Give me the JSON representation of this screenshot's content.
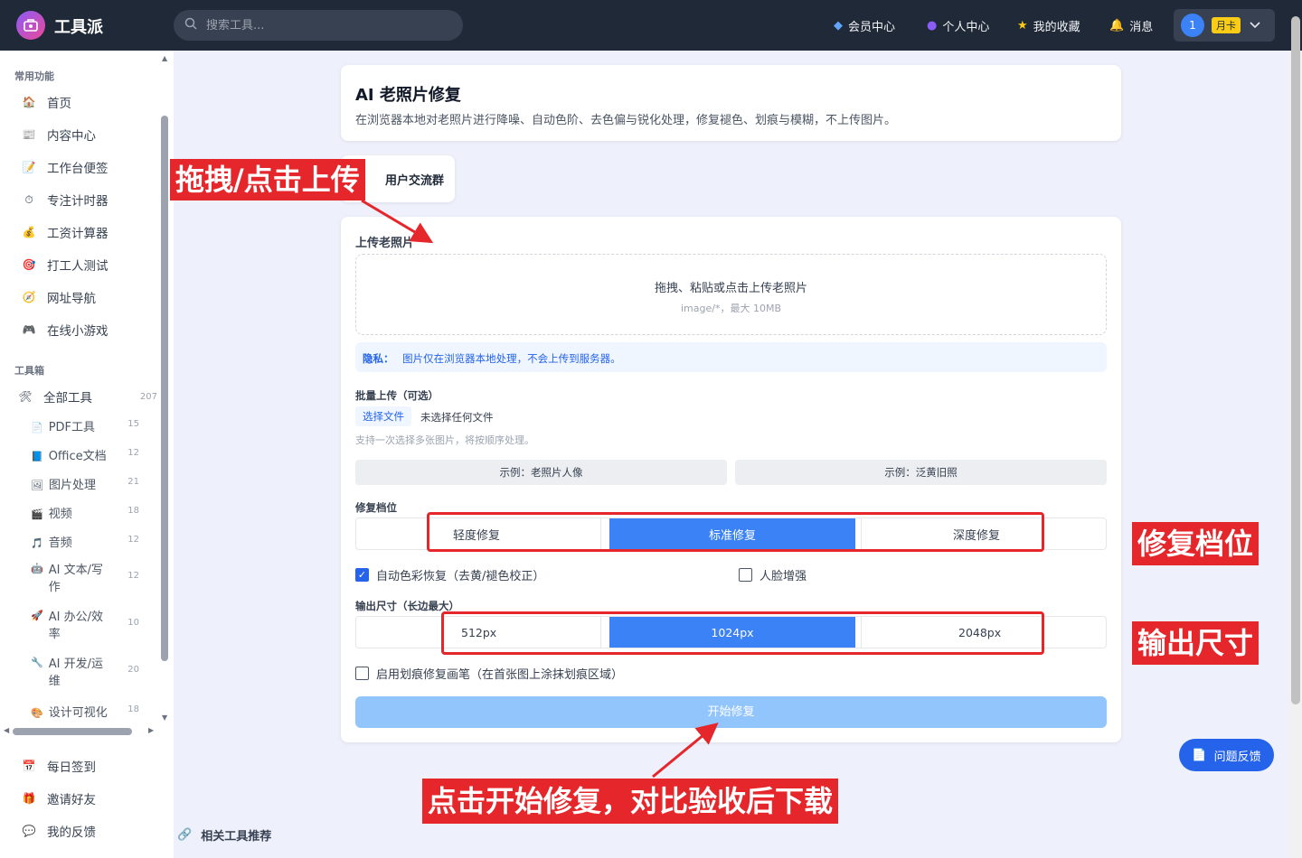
{
  "app": {
    "name": "工具派"
  },
  "search": {
    "placeholder": "搜索工具..."
  },
  "topnav": {
    "member": "会员中心",
    "personal": "个人中心",
    "favorites": "我的收藏",
    "messages": "消息",
    "user_badge": "1",
    "vip_label": "月卡"
  },
  "sidebar": {
    "common_title": "常用功能",
    "common": [
      {
        "icon": "🏠",
        "label": "首页"
      },
      {
        "icon": "📰",
        "label": "内容中心"
      },
      {
        "icon": "📝",
        "label": "工作台便签"
      },
      {
        "icon": "⏱",
        "label": "专注计时器"
      },
      {
        "icon": "💰",
        "label": "工资计算器"
      },
      {
        "icon": "🎯",
        "label": "打工人测试"
      },
      {
        "icon": "🧭",
        "label": "网址导航"
      },
      {
        "icon": "🎮",
        "label": "在线小游戏"
      }
    ],
    "toolbox_title": "工具箱",
    "all_tools": {
      "label": "全部工具",
      "count": "207"
    },
    "tools": [
      {
        "icon": "📄",
        "label": "PDF工具",
        "count": "15"
      },
      {
        "icon": "📘",
        "label": "Office文档",
        "count": "12"
      },
      {
        "icon": "🖼",
        "label": "图片处理",
        "count": "21"
      },
      {
        "icon": "🎬",
        "label": "视频",
        "count": "18"
      },
      {
        "icon": "🎵",
        "label": "音频",
        "count": "12"
      },
      {
        "icon": "🤖",
        "label": "AI 文本/写作",
        "count": "12"
      },
      {
        "icon": "🚀",
        "label": "AI 办公/效率",
        "count": "10"
      },
      {
        "icon": "🔧",
        "label": "AI 开发/运维",
        "count": "20"
      },
      {
        "icon": "🎨",
        "label": "设计可视化",
        "count": "18"
      }
    ],
    "bottom": [
      {
        "icon": "📅",
        "label": "每日签到"
      },
      {
        "icon": "🎁",
        "label": "邀请好友"
      },
      {
        "icon": "💬",
        "label": "我的反馈"
      }
    ]
  },
  "page": {
    "title": "AI 老照片修复",
    "description": "在浏览器本地对老照片进行降噪、自动色阶、去色偏与锐化处理，修复褪色、划痕与模糊，不上传图片。",
    "group_button": "用户交流群",
    "upload_label": "上传老照片",
    "upload_main": "拖拽、粘贴或点击上传老照片",
    "upload_hint": "image/*，最大 10MB",
    "privacy_label": "隐私：",
    "privacy_text": "图片仅在浏览器本地处理，不会上传到服务器。",
    "batch_label": "批量上传（可选）",
    "choose_file": "选择文件",
    "no_file": "未选择任何文件",
    "batch_hint": "支持一次选择多张图片，将按顺序处理。",
    "example1": "示例：老照片人像",
    "example2": "示例：泛黄旧照",
    "level_label": "修复档位",
    "levels": [
      "轻度修复",
      "标准修复",
      "深度修复"
    ],
    "auto_color": "自动色彩恢复（去黄/褪色校正）",
    "auto_color_checked": true,
    "face_enhance": "人脸增强",
    "face_enhance_checked": false,
    "size_label": "输出尺寸（长边最大）",
    "sizes": [
      "512px",
      "1024px",
      "2048px"
    ],
    "scratch_brush": "启用划痕修复画笔（在首张图上涂抹划痕区域）",
    "start_button": "开始修复",
    "related_title": "相关工具推荐",
    "feedback_button": "问题反馈"
  },
  "annotations": {
    "upload": "拖拽/点击上传",
    "level": "修复档位",
    "size": "输出尺寸",
    "start": "点击开始修复，对比验收后下载"
  },
  "colors": {
    "accent": "#3b82f6",
    "annotation": "#e5262b",
    "topbar": "#1f2937"
  }
}
